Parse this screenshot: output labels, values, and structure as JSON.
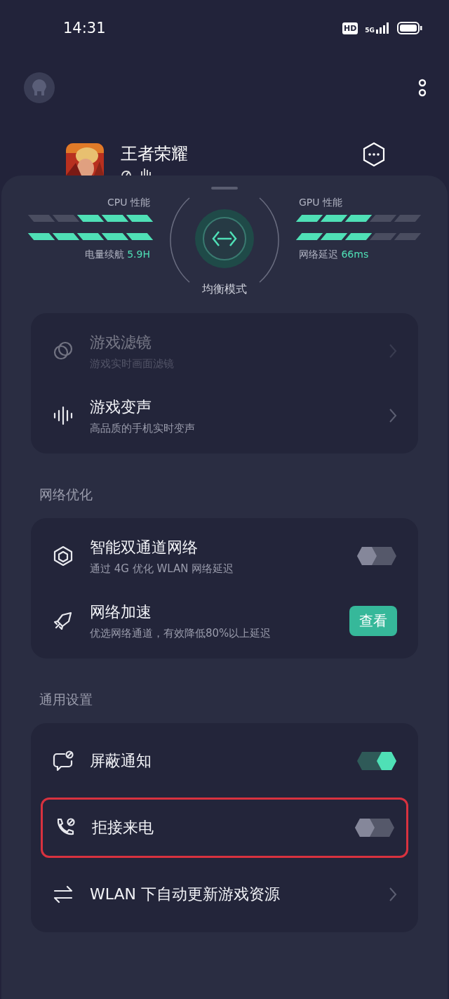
{
  "status_bar": {
    "time": "14:31",
    "hd_badge": "HD",
    "network": "5G"
  },
  "game": {
    "title": "王者荣耀"
  },
  "performance": {
    "left": {
      "title": "CPU 性能",
      "meters": [
        {
          "segments": [
            {
              "on": true
            },
            {
              "on": true
            },
            {
              "on": true
            },
            {
              "on": false
            },
            {
              "on": false
            }
          ]
        },
        {
          "segments": [
            {
              "on": true
            },
            {
              "on": true
            },
            {
              "on": true
            },
            {
              "on": true
            },
            {
              "on": true
            }
          ]
        }
      ],
      "stat_label": "电量续航",
      "stat_value": "5.9H"
    },
    "mode": "均衡模式",
    "right": {
      "title": "GPU 性能",
      "meters": [
        {
          "segments": [
            {
              "on": true
            },
            {
              "on": true
            },
            {
              "on": true
            },
            {
              "on": false
            },
            {
              "on": false
            }
          ]
        },
        {
          "segments": [
            {
              "on": true
            },
            {
              "on": true
            },
            {
              "on": true
            },
            {
              "on": false
            },
            {
              "on": false
            }
          ]
        }
      ],
      "stat_label": "网络延迟",
      "stat_value": "66ms"
    }
  },
  "sections": [
    {
      "rows": [
        {
          "kind": "link",
          "title": "游戏滤镜",
          "subtitle": "游戏实时画面滤镜",
          "dimmed": true,
          "highlighted": false
        },
        {
          "kind": "link",
          "title": "游戏变声",
          "subtitle": "高品质的手机实时变声",
          "dimmed": false,
          "highlighted": false
        }
      ]
    },
    {
      "title": "网络优化",
      "rows": [
        {
          "kind": "toggle",
          "title": "智能双通道网络",
          "subtitle": "通过 4G 优化 WLAN 网络延迟",
          "on": false,
          "dimmed": false,
          "highlighted": false
        },
        {
          "kind": "button",
          "title": "网络加速",
          "subtitle": "优选网络通道，有效降低80%以上延迟",
          "button": "查看",
          "dimmed": false,
          "highlighted": false
        }
      ]
    },
    {
      "title": "通用设置",
      "rows": [
        {
          "kind": "toggle",
          "title": "屏蔽通知",
          "on": true,
          "dimmed": false,
          "highlighted": false
        },
        {
          "kind": "toggle",
          "title": "拒接来电",
          "on": false,
          "dimmed": false,
          "highlighted": true
        },
        {
          "kind": "link",
          "title": "WLAN 下自动更新游戏资源",
          "dimmed": false,
          "highlighted": false
        }
      ]
    }
  ]
}
